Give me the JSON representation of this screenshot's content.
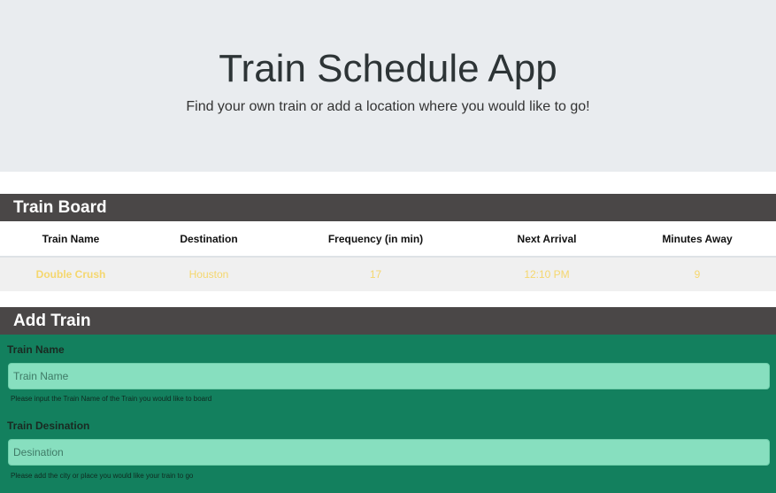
{
  "jumbotron": {
    "title": "Train Schedule App",
    "subtitle": "Find your own train or add a location where you would like to go!"
  },
  "board": {
    "header": "Train Board",
    "columns": [
      "Train Name",
      "Destination",
      "Frequency (in min)",
      "Next Arrival",
      "Minutes Away"
    ],
    "rows": [
      [
        "Double Crush",
        "Houston",
        "17",
        "12:10 PM",
        "9"
      ]
    ]
  },
  "add_train": {
    "header": "Add Train",
    "fields": [
      {
        "label": "Train Name",
        "placeholder": "Train Name",
        "value": "",
        "help": "Please input the Train Name of the Train you would like to board"
      },
      {
        "label": "Train Desination",
        "placeholder": "Desination",
        "value": "",
        "help": "Please add the city or place you would like your train to go"
      }
    ]
  },
  "colors": {
    "jumbotron_bg": "#e9ecef",
    "header_bg": "#4a4747",
    "form_bg": "#13805e",
    "input_bg": "#87dfbf",
    "row_text": "#f5d76e"
  }
}
